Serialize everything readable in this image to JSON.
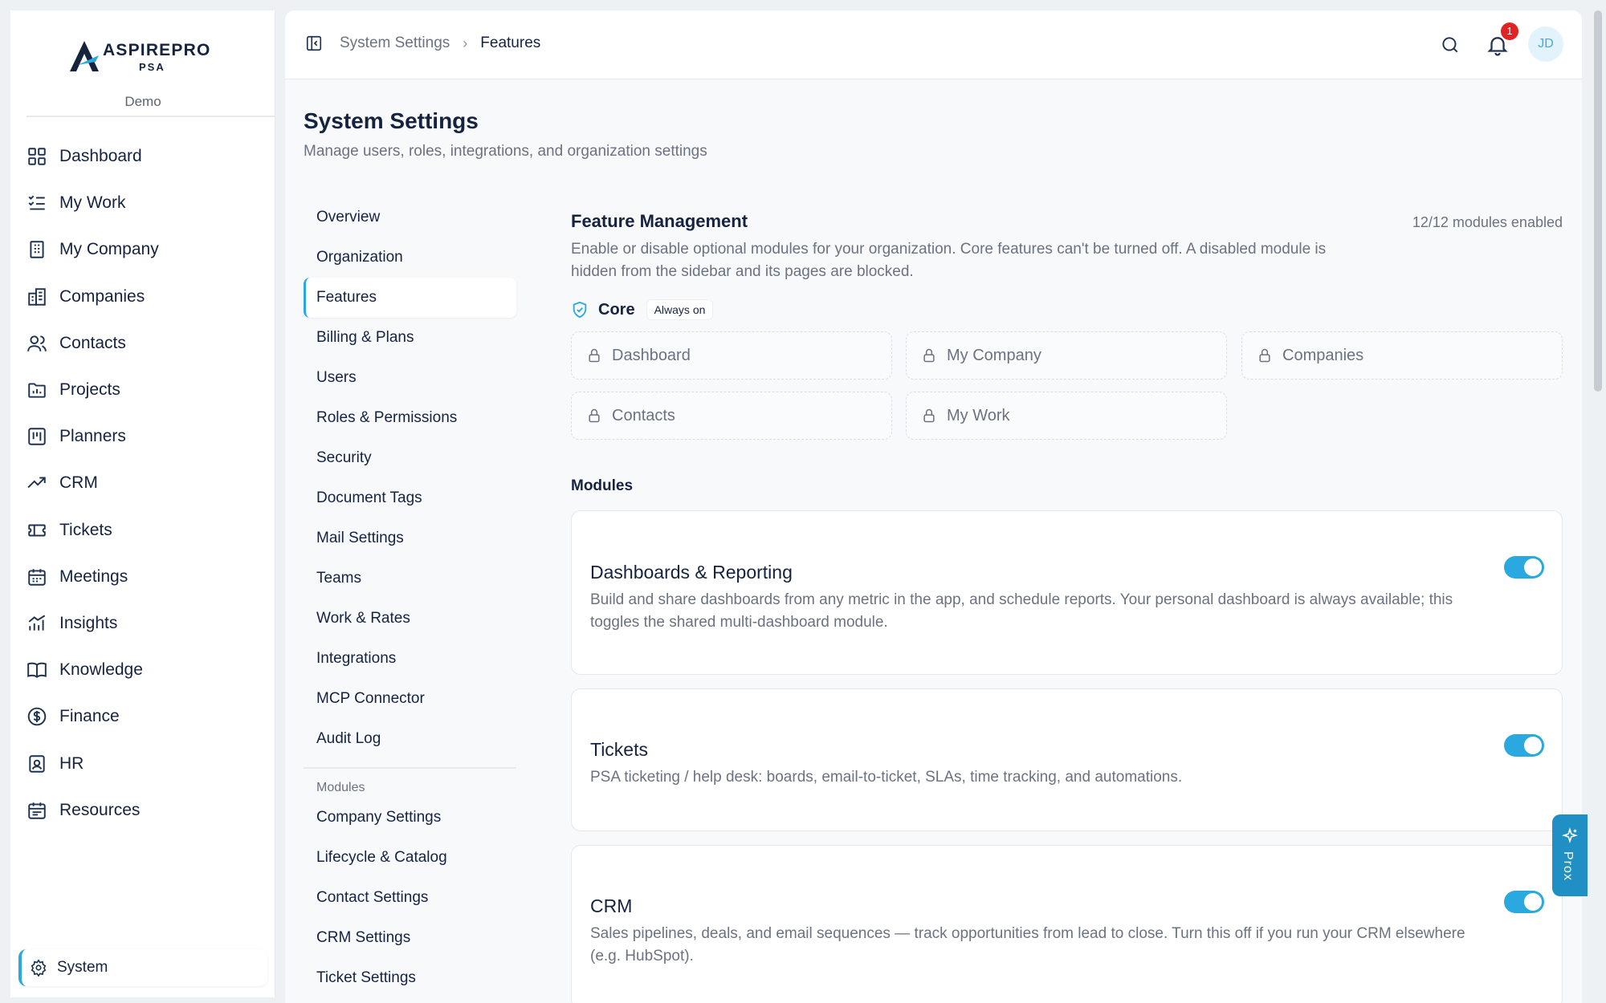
{
  "brand": {
    "name": "ASPIREPRO",
    "sub": "PSA",
    "org": "Demo"
  },
  "sidebar": {
    "items": [
      {
        "label": "Dashboard",
        "icon": "dashboard-icon"
      },
      {
        "label": "My Work",
        "icon": "list-check-icon"
      },
      {
        "label": "My Company",
        "icon": "building-icon"
      },
      {
        "label": "Companies",
        "icon": "buildings-icon"
      },
      {
        "label": "Contacts",
        "icon": "users-icon"
      },
      {
        "label": "Projects",
        "icon": "folder-icon"
      },
      {
        "label": "Planners",
        "icon": "kanban-icon"
      },
      {
        "label": "CRM",
        "icon": "trend-up-icon"
      },
      {
        "label": "Tickets",
        "icon": "ticket-icon"
      },
      {
        "label": "Meetings",
        "icon": "calendar-icon"
      },
      {
        "label": "Insights",
        "icon": "bar-chart-icon"
      },
      {
        "label": "Knowledge",
        "icon": "book-icon"
      },
      {
        "label": "Finance",
        "icon": "dollar-icon"
      },
      {
        "label": "HR",
        "icon": "id-badge-icon"
      },
      {
        "label": "Resources",
        "icon": "calendar-grid-icon"
      }
    ],
    "system_label": "System"
  },
  "topbar": {
    "breadcrumb": [
      "System Settings",
      "Features"
    ],
    "notifications_count": "1",
    "avatar_initials": "JD"
  },
  "page": {
    "title": "System Settings",
    "subtitle": "Manage users, roles, integrations, and organization settings"
  },
  "subnav": {
    "items": [
      "Overview",
      "Organization",
      "Features",
      "Billing & Plans",
      "Users",
      "Roles & Permissions",
      "Security",
      "Document Tags",
      "Mail Settings",
      "Teams",
      "Work & Rates",
      "Integrations",
      "MCP Connector",
      "Audit Log"
    ],
    "active": "Features",
    "modules_heading": "Modules",
    "module_items": [
      "Company Settings",
      "Lifecycle & Catalog",
      "Contact Settings",
      "CRM Settings",
      "Ticket Settings"
    ]
  },
  "features": {
    "title": "Feature Management",
    "count": "12/12 modules enabled",
    "description": "Enable or disable optional modules for your organization. Core features can't be turned off. A disabled module is hidden from the sidebar and its pages are blocked.",
    "core_label": "Core",
    "core_badge": "Always on",
    "core_items": [
      "Dashboard",
      "My Company",
      "Companies",
      "Contacts",
      "My Work"
    ],
    "modules_heading": "Modules",
    "modules": [
      {
        "title": "Dashboards & Reporting",
        "description": "Build and share dashboards from any metric in the app, and schedule reports. Your personal dashboard is always available; this toggles the shared multi-dashboard module.",
        "enabled": true
      },
      {
        "title": "Tickets",
        "description": "PSA ticketing / help desk: boards, email-to-ticket, SLAs, time tracking, and automations.",
        "enabled": true
      },
      {
        "title": "CRM",
        "description": "Sales pipelines, deals, and email sequences — track opportunities from lead to close. Turn this off if you run your CRM elsewhere (e.g. HubSpot).",
        "enabled": true
      }
    ]
  },
  "assistant": {
    "label": "Prox"
  },
  "colors": {
    "accent": "#2aa9e0",
    "text": "#16233f",
    "muted": "#6b7280",
    "badge": "#e02424"
  }
}
